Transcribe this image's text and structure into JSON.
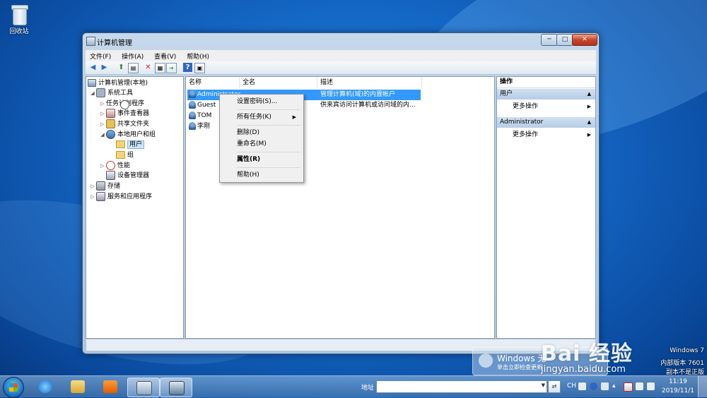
{
  "desktop": {
    "recycle_bin_label": "回收站"
  },
  "window": {
    "title": "计算机管理",
    "controls": {
      "minimize": "─",
      "maximize": "□",
      "close": "✕"
    },
    "menu": [
      "文件(F)",
      "操作(A)",
      "查看(V)",
      "帮助(H)"
    ],
    "toolbar_icons": [
      "back-icon",
      "forward-icon",
      "up-icon",
      "show-tree-icon",
      "delete-icon",
      "properties-icon",
      "export-icon",
      "help-icon",
      "view-icon"
    ]
  },
  "tree": {
    "root": "计算机管理(本地)",
    "system_tools": "系统工具",
    "task_scheduler": "任务计划程序",
    "event_viewer": "事件查看器",
    "shared_folders": "共享文件夹",
    "local_users_groups": "本地用户和组",
    "users": "用户",
    "groups": "组",
    "performance": "性能",
    "device_manager": "设备管理器",
    "storage": "存储",
    "services_apps": "服务和应用程序"
  },
  "list": {
    "columns": [
      "名称",
      "全名",
      "描述"
    ],
    "rows": [
      {
        "name": "Administrator",
        "full": "",
        "desc": "管理计算机(域)的内置帐户"
      },
      {
        "name": "Guest",
        "full": "",
        "desc": "供来宾访问计算机或访问域的内..."
      },
      {
        "name": "TOM",
        "full": "",
        "desc": ""
      },
      {
        "name": "李刚",
        "full": "",
        "desc": ""
      }
    ]
  },
  "context_menu": {
    "set_password": "设置密码(S)...",
    "all_tasks": "所有任务(K)",
    "delete": "删除(D)",
    "rename": "重命名(M)",
    "properties": "属性(R)",
    "help": "帮助(H)"
  },
  "actions": {
    "header": "操作",
    "section1": "用户",
    "section1_item": "更多操作",
    "section2": "Administrator",
    "section2_item": "更多操作"
  },
  "watermark": {
    "logo": "Bai 经验",
    "url": "jingyan.baidu.com",
    "notice_title": "Windows 无",
    "notice_sub": "单击立即检查更新"
  },
  "os_version": {
    "line1": "Windows 7",
    "line2": "内部版本 7601",
    "line3": "副本不是正版"
  },
  "taskbar": {
    "address_label": "地址",
    "address_value": "",
    "lang": "CH",
    "time": "11:19",
    "date": "2019/11/1"
  }
}
